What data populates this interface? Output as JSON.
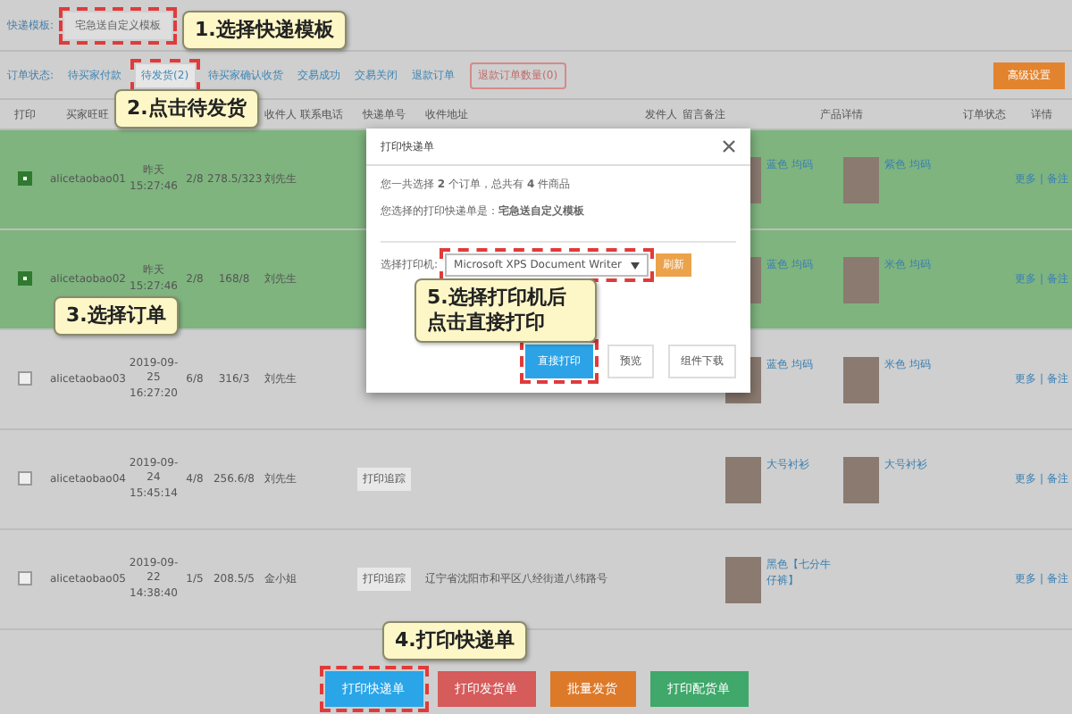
{
  "template_bar": {
    "label": "快递模板:",
    "value": "宅急送自定义模板"
  },
  "status_tabs": {
    "label": "订单状态:",
    "items": [
      {
        "label": "待买家付款",
        "selected": false
      },
      {
        "label": "待发货(2)",
        "selected": true
      },
      {
        "label": "待买家确认收货",
        "selected": false
      },
      {
        "label": "交易成功",
        "selected": false
      },
      {
        "label": "交易关闭",
        "selected": false
      },
      {
        "label": "退款订单",
        "selected": false
      }
    ],
    "refund": "退款订单数量(0)",
    "settings": "高级设置"
  },
  "table": {
    "columns": [
      "打印",
      "买家旺旺",
      "",
      "",
      "",
      "收件人",
      "联系电话",
      "快递单号",
      "收件地址",
      "发件人",
      "留言备注",
      "产品详情",
      "订单状态",
      "详情"
    ],
    "rows": [
      {
        "selected": true,
        "buyer": "alicetaobao01",
        "date": "昨天",
        "time": "15:27:46",
        "qty": "2/8",
        "amount": "278.5/323",
        "receiver": "刘先生",
        "products": [
          "蓝色 均码",
          "紫色 均码"
        ],
        "links": "更多 | 备注"
      },
      {
        "selected": true,
        "buyer": "alicetaobao02",
        "date": "昨天",
        "time": "15:27:46",
        "qty": "2/8",
        "amount": "168/8",
        "receiver": "刘先生",
        "products": [
          "蓝色 均码",
          "米色 均码"
        ],
        "links": "更多 | 备注"
      },
      {
        "selected": false,
        "buyer": "alicetaobao03",
        "date": "2019-09-25",
        "time": "16:27:20",
        "qty": "6/8",
        "amount": "316/3",
        "receiver": "刘先生",
        "products": [
          "蓝色 均码",
          "米色 均码"
        ],
        "links": "更多 | 备注"
      },
      {
        "selected": false,
        "buyer": "alicetaobao04",
        "date": "2019-09-24",
        "time": "15:45:14",
        "qty": "4/8",
        "amount": "256.6/8",
        "receiver": "刘先生",
        "tracking": "打印追踪",
        "products": [
          "大号衬衫",
          "大号衬衫"
        ],
        "links": "更多 | 备注"
      },
      {
        "selected": false,
        "buyer": "alicetaobao05",
        "date": "2019-09-22",
        "time": "14:38:40",
        "qty": "1/5",
        "amount": "208.5/5",
        "receiver": "金小姐",
        "tracking": "打印追踪",
        "address": "辽宁省沈阳市和平区八经街道八纬路号",
        "products": [
          "黑色【七分牛仔裤】"
        ],
        "links": "更多 | 备注"
      }
    ]
  },
  "dialog": {
    "title": "打印快递单",
    "summary": "您一共选择 **2** 个订单，总共有 **4** 件商品",
    "template": "您选择的打印快递单是：**宅急送自定义模板**",
    "printer_label": "选择打印机:",
    "printer": "Microsoft XPS Document Writer",
    "refresh": "刷新",
    "buttons": [
      "直接打印",
      "预览",
      "组件下载"
    ]
  },
  "footer_buttons": [
    {
      "label": "打印快递单",
      "kind": "blue"
    },
    {
      "label": "打印发货单",
      "kind": "red"
    },
    {
      "label": "批量发货",
      "kind": "orange"
    },
    {
      "label": "打印配货单",
      "kind": "green"
    }
  ],
  "callouts": [
    "1.选择快递模板",
    "2.点击待发货",
    "3.选择订单",
    "5.选择打印机后点击直接打印",
    "4.打印快递单"
  ]
}
